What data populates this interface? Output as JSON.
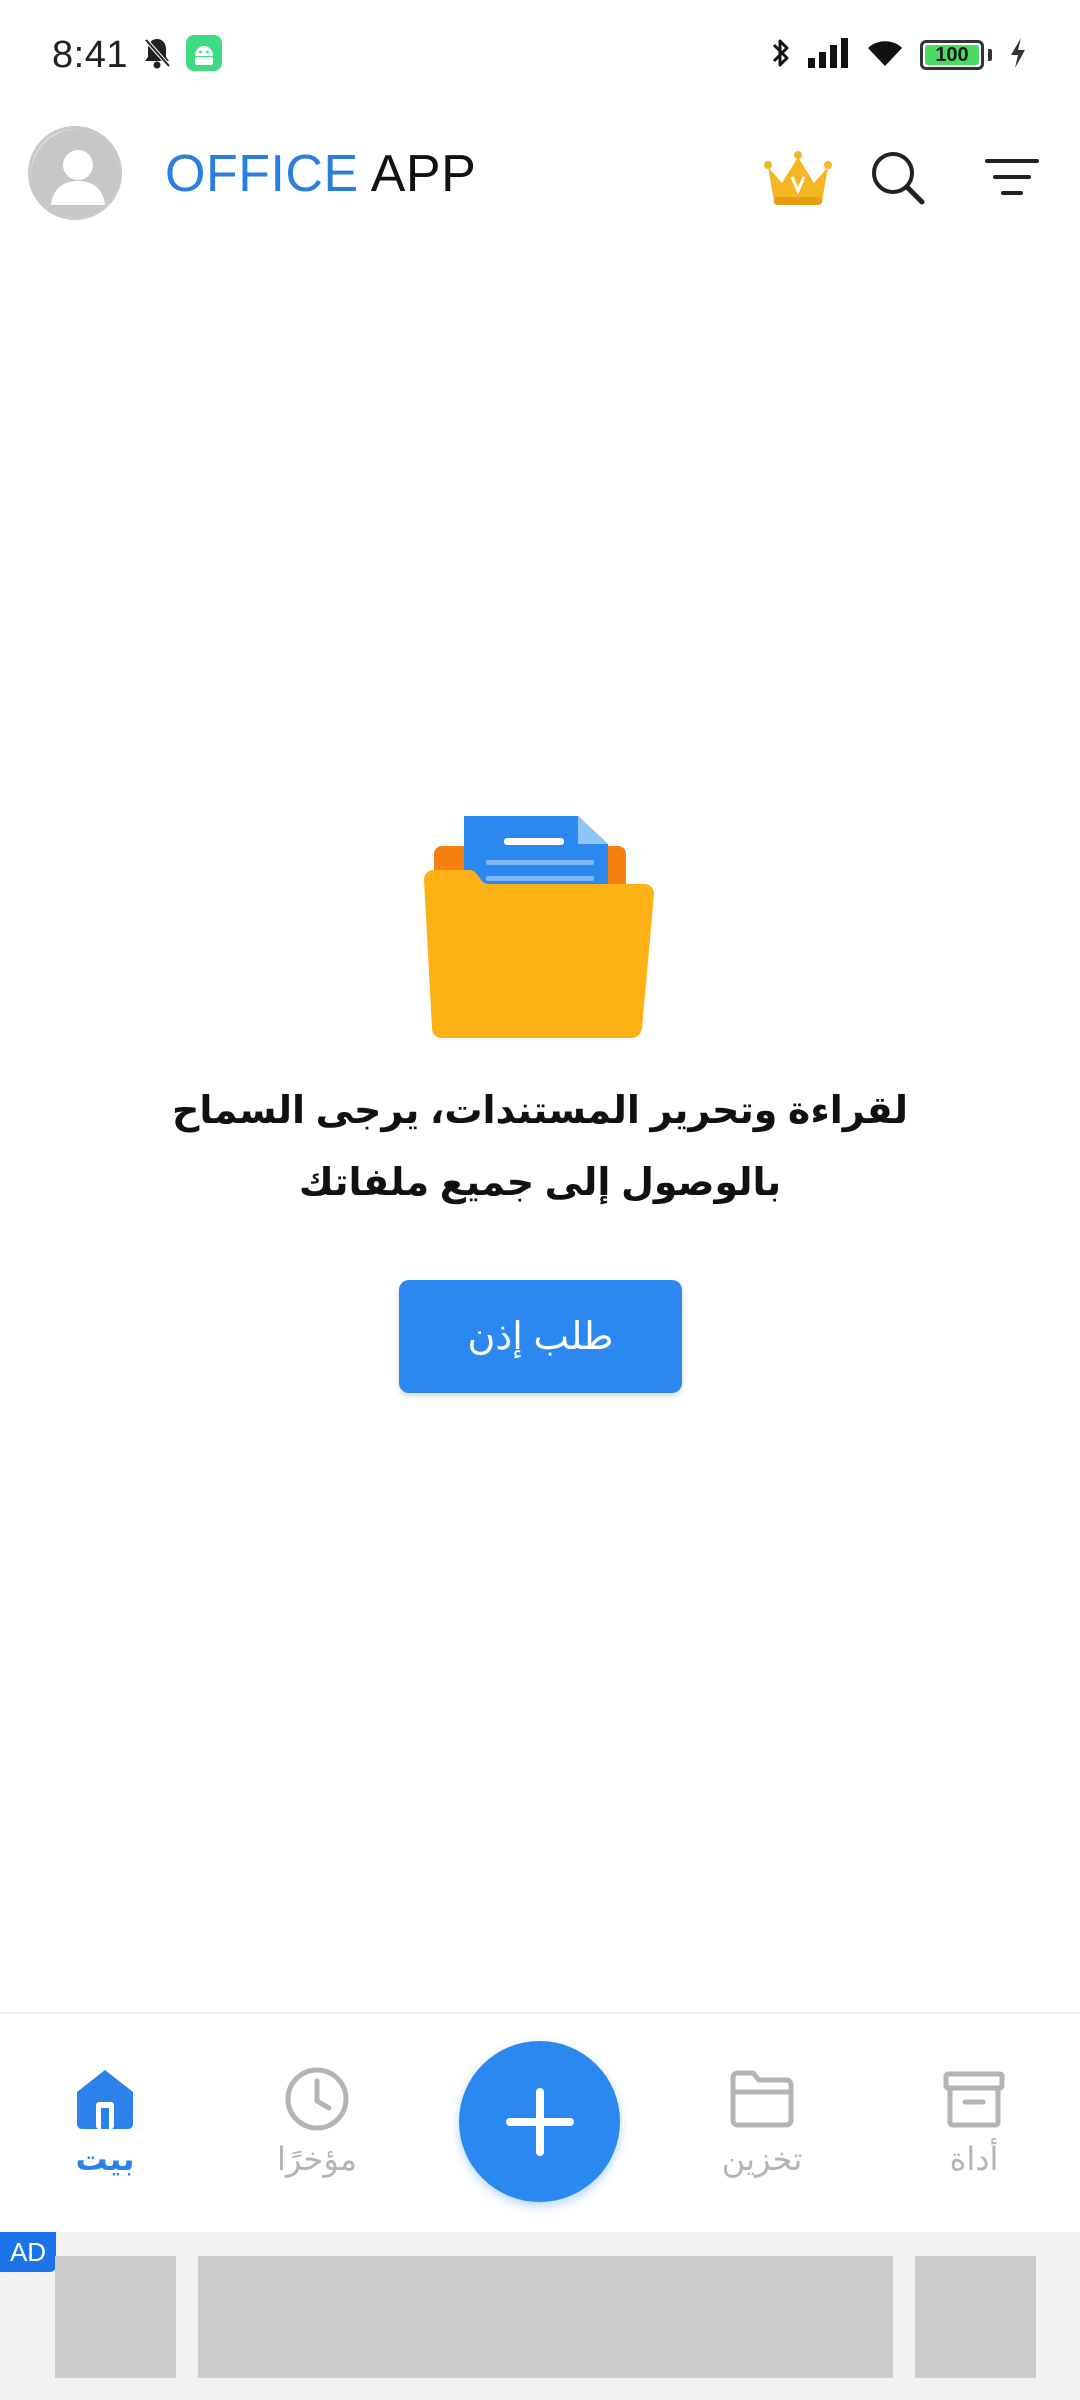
{
  "status_bar": {
    "time": "8:41",
    "battery_level": "100",
    "icons": [
      "muted-bell-icon",
      "android-icon",
      "bluetooth-icon",
      "signal-icon",
      "wifi-icon",
      "battery-icon",
      "charging-icon"
    ]
  },
  "app_bar": {
    "title_part1": "OFFICE",
    "title_part2": "APP",
    "title_color_primary": "#2a7de1",
    "icons": [
      "avatar-icon",
      "crown-icon",
      "search-icon",
      "filter-icon"
    ]
  },
  "empty_state": {
    "message": "لقراءة وتحرير المستندات، يرجى السماح بالوصول إلى جميع ملفاتك",
    "button_label": "طلب إذن",
    "illustration": "folder-documents-icon"
  },
  "bottom_nav": {
    "items": [
      {
        "label": "بيت",
        "icon": "home-icon",
        "active": true
      },
      {
        "label": "مؤخرًا",
        "icon": "clock-icon",
        "active": false
      },
      {
        "label": "تخزين",
        "icon": "folder-icon",
        "active": false
      },
      {
        "label": "أداة",
        "icon": "archive-box-icon",
        "active": false
      }
    ],
    "fab_icon": "plus-icon",
    "accent_color": "#2a88f0"
  },
  "ad": {
    "badge": "AD"
  }
}
